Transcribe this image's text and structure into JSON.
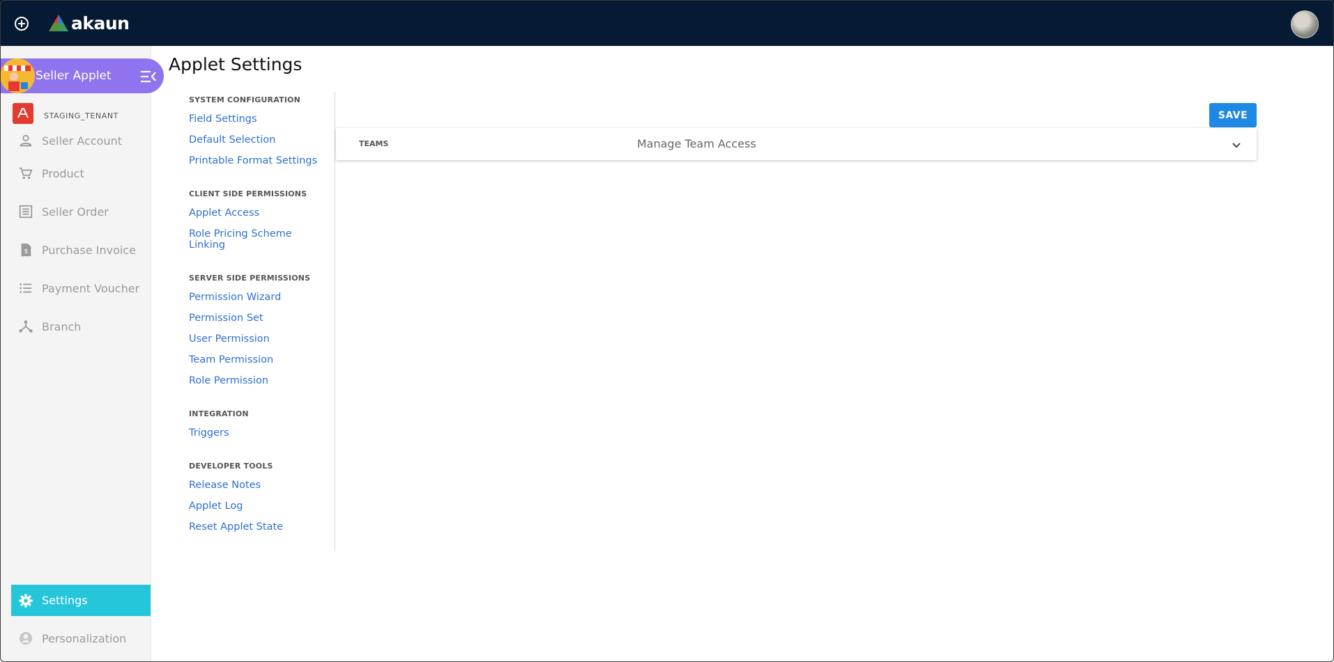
{
  "app": {
    "logo_text": "akaun",
    "applet_title": "Seller Applet",
    "tenant": "STAGING_TENANT"
  },
  "sidebar": {
    "items": [
      {
        "label": "Seller Account",
        "icon": "person-icon"
      },
      {
        "label": "Product",
        "icon": "cart-icon"
      },
      {
        "label": "Seller Order",
        "icon": "list-box-icon"
      },
      {
        "label": "Purchase Invoice",
        "icon": "invoice-icon"
      },
      {
        "label": "Payment Voucher",
        "icon": "list-icon"
      },
      {
        "label": "Branch",
        "icon": "branch-icon"
      }
    ],
    "settings_label": "Settings",
    "personalization_label": "Personalization"
  },
  "page": {
    "title": "Applet Settings",
    "save_label": "SAVE"
  },
  "settings_nav": [
    {
      "title": "SYSTEM CONFIGURATION",
      "links": [
        "Field Settings",
        "Default Selection",
        "Printable Format Settings"
      ]
    },
    {
      "title": "CLIENT SIDE PERMISSIONS",
      "links": [
        "Applet Access",
        "Role Pricing Scheme Linking"
      ]
    },
    {
      "title": "SERVER SIDE PERMISSIONS",
      "links": [
        "Permission Wizard",
        "Permission Set",
        "User Permission",
        "Team Permission",
        "Role Permission"
      ]
    },
    {
      "title": "INTEGRATION",
      "links": [
        "Triggers"
      ]
    },
    {
      "title": "DEVELOPER TOOLS",
      "links": [
        "Release Notes",
        "Applet Log",
        "Reset Applet State"
      ]
    }
  ],
  "panel": {
    "label": "TEAMS",
    "description": "Manage Team Access"
  },
  "colors": {
    "topbar": "#061a33",
    "applet_header": "#8f73ef",
    "settings_active": "#26c6da",
    "link": "#2e6fd0",
    "save_button": "#1e88e5"
  }
}
